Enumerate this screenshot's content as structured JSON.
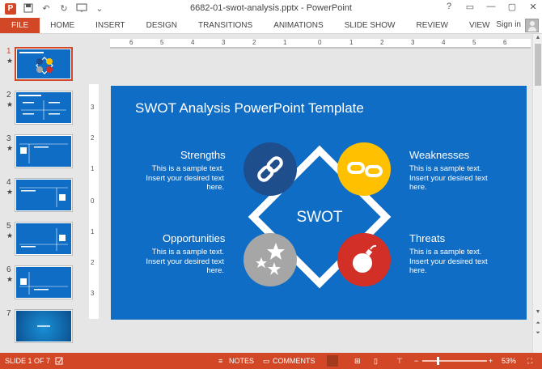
{
  "window": {
    "title": "6682-01-swot-analysis.pptx - PowerPoint",
    "controls": [
      "?",
      "▭",
      "—",
      "▢",
      "✕"
    ]
  },
  "quick_access": {
    "app_icon": "powerpoint-icon",
    "items": [
      "save-icon",
      "undo-icon",
      "redo-icon",
      "present-icon",
      "customize-icon"
    ]
  },
  "ribbon": {
    "tabs": [
      "FILE",
      "HOME",
      "INSERT",
      "DESIGN",
      "TRANSITIONS",
      "ANIMATIONS",
      "SLIDE SHOW",
      "REVIEW",
      "VIEW"
    ],
    "sign_in": "Sign in"
  },
  "thumbnails": [
    {
      "num": "1",
      "star": "★",
      "active": true
    },
    {
      "num": "2",
      "star": "★",
      "active": false
    },
    {
      "num": "3",
      "star": "★",
      "active": false
    },
    {
      "num": "4",
      "star": "★",
      "active": false
    },
    {
      "num": "5",
      "star": "★",
      "active": false
    },
    {
      "num": "6",
      "star": "★",
      "active": false
    },
    {
      "num": "7",
      "star": "",
      "active": false
    }
  ],
  "rulers": {
    "horizontal": [
      "6",
      "5",
      "4",
      "3",
      "2",
      "1",
      "0",
      "1",
      "2",
      "3",
      "4",
      "5",
      "6"
    ],
    "vertical": [
      "3",
      "2",
      "1",
      "0",
      "1",
      "2",
      "3"
    ]
  },
  "slide": {
    "title": "SWOT Analysis PowerPoint Template",
    "center": "SWOT",
    "quadrants": {
      "strengths": {
        "heading": "Strengths",
        "lines": [
          "This is a sample text.",
          "Insert your desired text",
          "here."
        ],
        "color": "#1f4e8c",
        "icon": "link-icon"
      },
      "weaknesses": {
        "heading": "Weaknesses",
        "lines": [
          "This is a sample text.",
          "Insert your desired text",
          "here."
        ],
        "color": "#ffc000",
        "icon": "broken-link-icon"
      },
      "opportunities": {
        "heading": "Opportunities",
        "lines": [
          "This is a sample text.",
          "Insert your desired text",
          "here."
        ],
        "color": "#a6a6a6",
        "icon": "stars-icon"
      },
      "threats": {
        "heading": "Threats",
        "lines": [
          "This is a sample text.",
          "Insert your desired text",
          "here."
        ],
        "color": "#d22f27",
        "icon": "bomb-icon"
      }
    },
    "background": "#0f6dc6"
  },
  "statusbar": {
    "slide_info": "SLIDE 1 OF 7",
    "notes": "NOTES",
    "comments": "COMMENTS",
    "zoom": "53%",
    "accent": "#d24726"
  }
}
